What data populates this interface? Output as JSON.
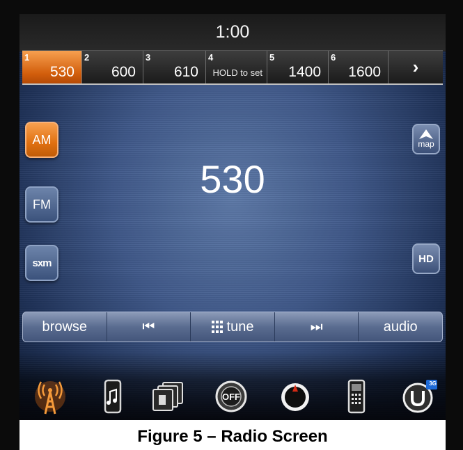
{
  "clock": "1:00",
  "presets": [
    {
      "num": "1",
      "freq": "530",
      "active": true
    },
    {
      "num": "2",
      "freq": "600"
    },
    {
      "num": "3",
      "freq": "610"
    },
    {
      "num": "4",
      "freq": "HOLD to set"
    },
    {
      "num": "5",
      "freq": "1400"
    },
    {
      "num": "6",
      "freq": "1600"
    }
  ],
  "preset_next": "›",
  "bands": {
    "am": "AM",
    "fm": "FM",
    "sxm": "sxm"
  },
  "current_frequency": "530",
  "map_label": "map",
  "hd_label": "HD",
  "transport": {
    "browse": "browse",
    "prev": "⏮",
    "tune": "tune",
    "next": "⏭",
    "audio": "audio"
  },
  "caption": "Figure 5 – Radio Screen",
  "colors": {
    "accent": "#e07010",
    "screen_bg": "#40598a"
  },
  "nav_icons": [
    "radio-icon",
    "media-icon",
    "apps-icon",
    "off-icon",
    "climate-icon",
    "phone-icon",
    "uconnect-icon"
  ],
  "uconnect_badge": "3G"
}
